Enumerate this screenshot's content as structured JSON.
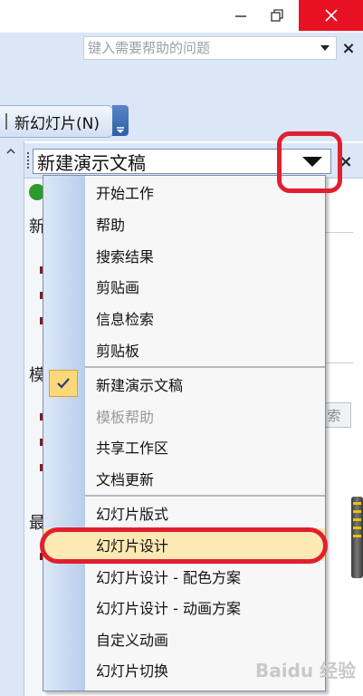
{
  "window": {
    "minimize_icon": "minimize-icon",
    "maximize_icon": "restore-icon",
    "close_icon": "close-icon",
    "close_color": "#e81123"
  },
  "help": {
    "placeholder": "键入需要帮助的问题",
    "close": "×"
  },
  "toolbar": {
    "new_slide_label": "新幻灯片(N)"
  },
  "leftstrip": {
    "scroll_up": "^",
    "chars": [
      "新",
      "模",
      "最"
    ]
  },
  "taskpane": {
    "title": "新建演示文稿",
    "close": "×",
    "search_button": "索"
  },
  "menu": {
    "items": [
      {
        "label": "开始工作",
        "enabled": true
      },
      {
        "label": "帮助",
        "enabled": true
      },
      {
        "label": "搜索结果",
        "enabled": true
      },
      {
        "label": "剪贴画",
        "enabled": true
      },
      {
        "label": "信息检索",
        "enabled": true
      },
      {
        "label": "剪贴板",
        "enabled": true
      },
      {
        "label": "新建演示文稿",
        "enabled": true,
        "checked": true
      },
      {
        "label": "模板帮助",
        "enabled": false
      },
      {
        "label": "共享工作区",
        "enabled": true
      },
      {
        "label": "文档更新",
        "enabled": true
      },
      {
        "label": "幻灯片版式",
        "enabled": true
      },
      {
        "label": "幻灯片设计",
        "enabled": true,
        "highlighted": true
      },
      {
        "label": "幻灯片设计 - 配色方案",
        "enabled": true
      },
      {
        "label": "幻灯片设计 - 动画方案",
        "enabled": true
      },
      {
        "label": "自定义动画",
        "enabled": true
      },
      {
        "label": "幻灯片切换",
        "enabled": true
      }
    ]
  },
  "annotation_color": "#e0202e",
  "watermark": "Baidu 经验"
}
